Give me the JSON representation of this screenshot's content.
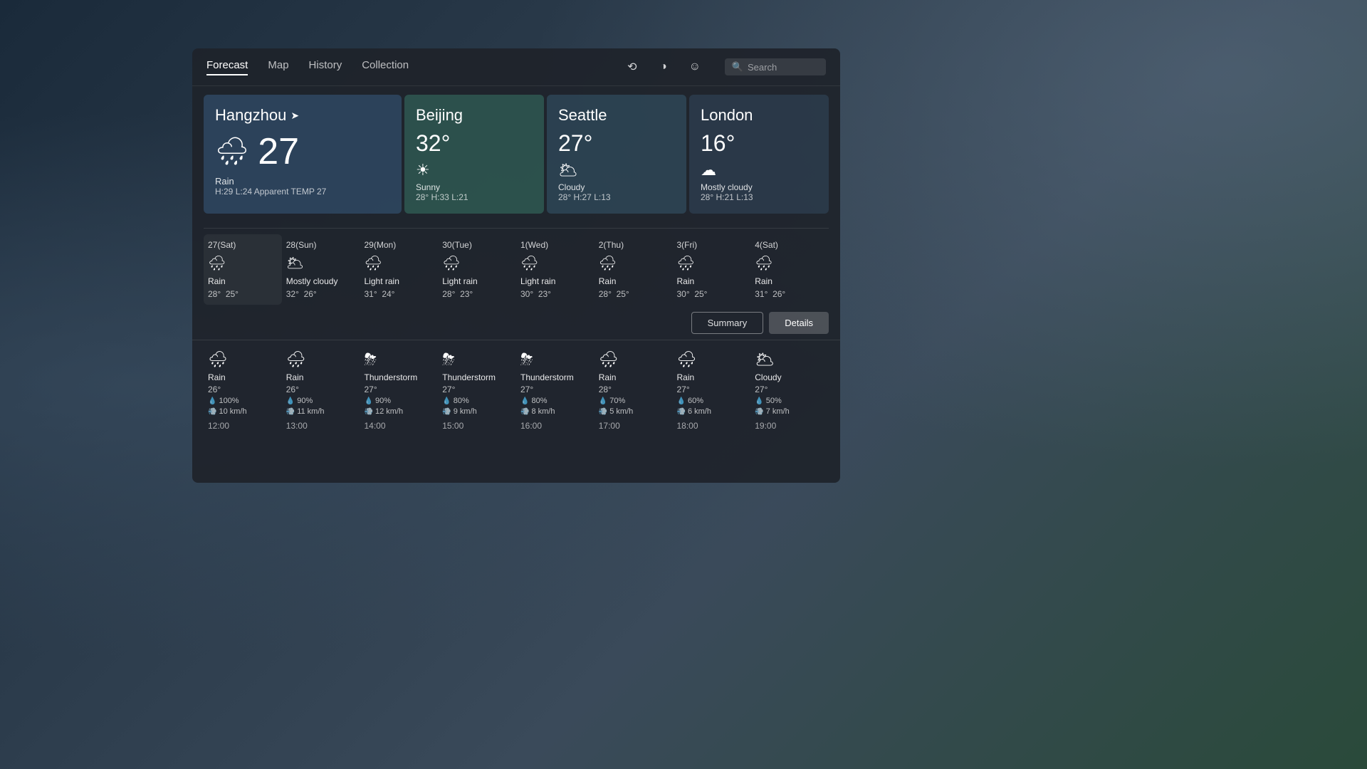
{
  "background": {
    "color1": "#1a2a3a",
    "color2": "#2a3a4a"
  },
  "nav": {
    "tabs": [
      {
        "id": "forecast",
        "label": "Forecast",
        "active": true
      },
      {
        "id": "map",
        "label": "Map",
        "active": false
      },
      {
        "id": "history",
        "label": "History",
        "active": false
      },
      {
        "id": "collection",
        "label": "Collection",
        "active": false
      }
    ],
    "search_placeholder": "Search",
    "icon_rotate": "⟲",
    "icon_contrast": "◑",
    "icon_face": "☺"
  },
  "main_city": {
    "name": "Hangzhou",
    "has_location": true,
    "icon": "🌧",
    "temperature": "27",
    "condition": "Rain",
    "high": "H:29",
    "low": "L:24",
    "apparent": "Apparent TEMP 27"
  },
  "secondary_cities": [
    {
      "id": "beijing",
      "name": "Beijing",
      "temperature": "32°",
      "icon": "☀",
      "condition": "Sunny",
      "high": "28°",
      "hval": "H:33",
      "low": "L:21",
      "css_class": "beijing"
    },
    {
      "id": "seattle",
      "name": "Seattle",
      "temperature": "27°",
      "icon": "🌥",
      "condition": "Cloudy",
      "high": "28°",
      "hval": "H:27",
      "low": "L:13",
      "css_class": "seattle"
    },
    {
      "id": "london",
      "name": "London",
      "temperature": "16°",
      "icon": "☁",
      "condition": "Mostly cloudy",
      "high": "28°",
      "hval": "H:21",
      "low": "L:13",
      "css_class": "london"
    }
  ],
  "daily_forecast": [
    {
      "day": "27(Sat)",
      "icon": "🌧",
      "condition": "Rain",
      "high": "28°",
      "low": "25°",
      "active": true
    },
    {
      "day": "28(Sun)",
      "icon": "🌥",
      "condition": "Mostly cloudy",
      "high": "32°",
      "low": "26°",
      "active": false
    },
    {
      "day": "29(Mon)",
      "icon": "🌧",
      "condition": "Light rain",
      "high": "31°",
      "low": "24°",
      "active": false
    },
    {
      "day": "30(Tue)",
      "icon": "🌧",
      "condition": "Light rain",
      "high": "28°",
      "low": "23°",
      "active": false
    },
    {
      "day": "1(Wed)",
      "icon": "🌧",
      "condition": "Light rain",
      "high": "30°",
      "low": "23°",
      "active": false
    },
    {
      "day": "2(Thu)",
      "icon": "🌧",
      "condition": "Rain",
      "high": "28°",
      "low": "25°",
      "active": false
    },
    {
      "day": "3(Fri)",
      "icon": "🌧",
      "condition": "Rain",
      "high": "30°",
      "low": "25°",
      "active": false
    },
    {
      "day": "4(Sat)",
      "icon": "🌧",
      "condition": "Rain",
      "high": "31°",
      "low": "26°",
      "active": false
    }
  ],
  "view_buttons": {
    "summary": "Summary",
    "details": "Details"
  },
  "hourly_forecast": [
    {
      "time": "12:00",
      "icon": "🌧",
      "condition": "Rain",
      "temp": "26°",
      "precip": "100%",
      "wind": "10 km/h"
    },
    {
      "time": "13:00",
      "icon": "🌧",
      "condition": "Rain",
      "temp": "26°",
      "precip": "90%",
      "wind": "11 km/h"
    },
    {
      "time": "14:00",
      "icon": "⛈",
      "condition": "Thunderstorm",
      "temp": "27°",
      "precip": "90%",
      "wind": "12 km/h"
    },
    {
      "time": "15:00",
      "icon": "⛈",
      "condition": "Thunderstorm",
      "temp": "27°",
      "precip": "80%",
      "wind": "9 km/h"
    },
    {
      "time": "16:00",
      "icon": "⛈",
      "condition": "Thunderstorm",
      "temp": "27°",
      "precip": "80%",
      "wind": "8 km/h"
    },
    {
      "time": "17:00",
      "icon": "🌧",
      "condition": "Rain",
      "temp": "28°",
      "precip": "70%",
      "wind": "5 km/h"
    },
    {
      "time": "18:00",
      "icon": "🌧",
      "condition": "Rain",
      "temp": "27°",
      "precip": "60%",
      "wind": "6 km/h"
    },
    {
      "time": "19:00",
      "icon": "🌥",
      "condition": "Cloudy",
      "temp": "27°",
      "precip": "50%",
      "wind": "7 km/h"
    }
  ]
}
